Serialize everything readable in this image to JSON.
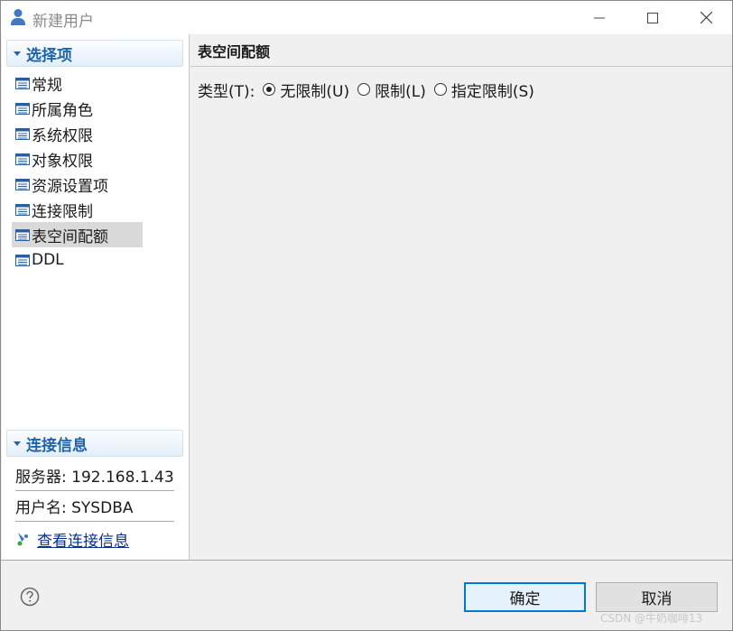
{
  "window": {
    "title": "新建用户",
    "title_icon": "user-icon",
    "controls": {
      "minimize": "minimize-icon",
      "maximize": "maximize-icon",
      "close": "close-icon"
    }
  },
  "left": {
    "section_title": "选择项",
    "nav_items": [
      {
        "label": "常规",
        "selected": false
      },
      {
        "label": "所属角色",
        "selected": false
      },
      {
        "label": "系统权限",
        "selected": false
      },
      {
        "label": "对象权限",
        "selected": false
      },
      {
        "label": "资源设置项",
        "selected": false
      },
      {
        "label": "连接限制",
        "selected": false
      },
      {
        "label": "表空间配额",
        "selected": true
      },
      {
        "label": "DDL",
        "selected": false
      }
    ],
    "connection": {
      "title": "连接信息",
      "server": "服务器: 192.168.1.43",
      "username": "用户名: SYSDBA",
      "link": "查看连接信息"
    }
  },
  "right": {
    "title": "表空间配额",
    "type_label": "类型(T):",
    "options": [
      {
        "label": "无限制(U)",
        "checked": true
      },
      {
        "label": "限制(L)",
        "checked": false
      },
      {
        "label": "指定限制(S)",
        "checked": false
      }
    ]
  },
  "footer": {
    "ok": "确定",
    "cancel": "取消",
    "watermark": "CSDN @牛奶咖啡13"
  },
  "colors": {
    "accent": "#1e64aa",
    "link": "#0b2f8a",
    "focus_border": "#0078d7",
    "selected_bg": "#d9d9d9"
  }
}
